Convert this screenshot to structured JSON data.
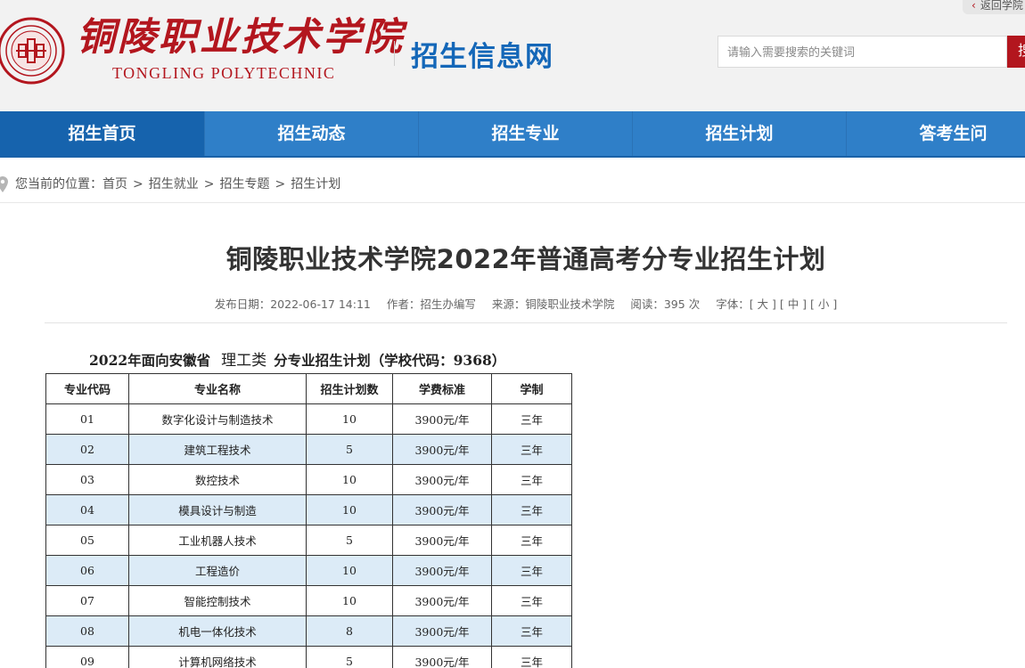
{
  "header": {
    "logo_cn": "铜陵职业技术学院",
    "logo_en": "TONGLING POLYTECHNIC",
    "site_title": "招生信息网",
    "back_link": "返回学院",
    "search_placeholder": "请输入需要搜索的关键词",
    "search_button": "搜索"
  },
  "nav": {
    "items": [
      {
        "label": "招生首页"
      },
      {
        "label": "招生动态"
      },
      {
        "label": "招生专业"
      },
      {
        "label": "招生计划"
      },
      {
        "label": "答考生问"
      }
    ],
    "active_color": "#1663ad",
    "bar_color": "#2f7fc8"
  },
  "breadcrumb": {
    "prefix": "您当前的位置：",
    "items": [
      "首页",
      "招生就业",
      "招生专题",
      "招生计划"
    ],
    "separator": ">"
  },
  "article": {
    "title": "铜陵职业技术学院2022年普通高考分专业招生计划",
    "meta": {
      "date": "发布日期：2022-06-17 14:11",
      "author": "作者：招生办编写",
      "source": "来源：铜陵职业技术学院",
      "views": "阅读：395 次",
      "font": "字体：[ 大 ] [ 中 ] [ 小 ]"
    },
    "table_caption": {
      "prefix": "2022年面向安徽省",
      "category": "理工类",
      "suffix": "分专业招生计划（学校代码：9368）"
    },
    "table": {
      "headers": [
        "专业代码",
        "专业名称",
        "招生计划数",
        "学费标准",
        "学制"
      ],
      "rows": [
        [
          "01",
          "数字化设计与制造技术",
          "10",
          "3900元/年",
          "三年"
        ],
        [
          "02",
          "建筑工程技术",
          "5",
          "3900元/年",
          "三年"
        ],
        [
          "03",
          "数控技术",
          "10",
          "3900元/年",
          "三年"
        ],
        [
          "04",
          "模具设计与制造",
          "10",
          "3900元/年",
          "三年"
        ],
        [
          "05",
          "工业机器人技术",
          "5",
          "3900元/年",
          "三年"
        ],
        [
          "06",
          "工程造价",
          "10",
          "3900元/年",
          "三年"
        ],
        [
          "07",
          "智能控制技术",
          "10",
          "3900元/年",
          "三年"
        ],
        [
          "08",
          "机电一体化技术",
          "8",
          "3900元/年",
          "三年"
        ],
        [
          "09",
          "计算机网络技术",
          "5",
          "3900元/年",
          "三年"
        ]
      ]
    }
  },
  "colors": {
    "brand_red": "#b3161e",
    "brand_blue": "#1467b8",
    "row_alt": "#dcebf7"
  },
  "icons": {
    "seal": "school-seal-icon",
    "pin": "location-pin-icon",
    "back": "chevron-left-icon"
  }
}
